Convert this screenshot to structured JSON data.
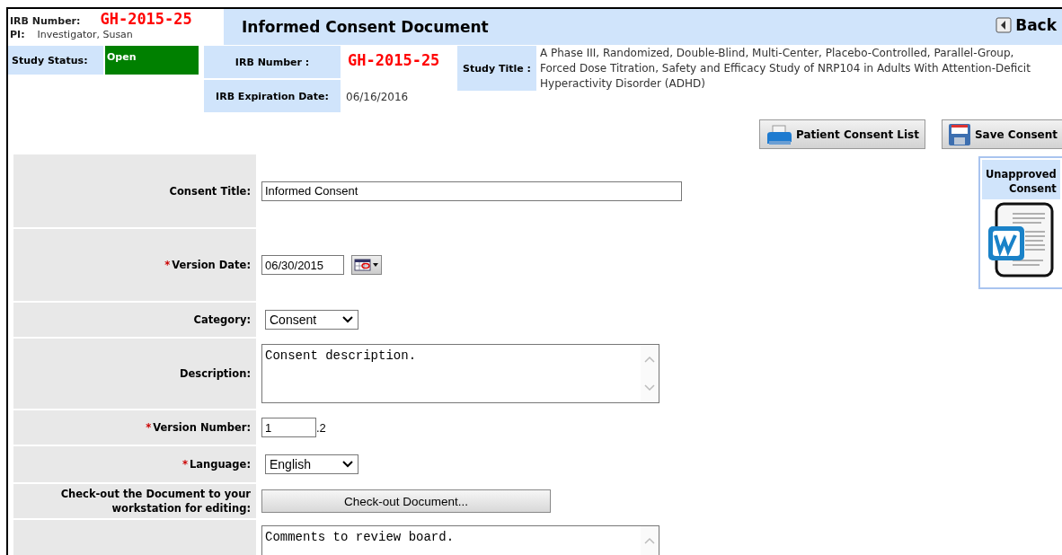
{
  "header": {
    "irb_label": "IRB Number:",
    "irb_number": "GH-2015-25",
    "pi_label": "PI:",
    "pi_name": "Investigator, Susan",
    "title": "Informed Consent Document",
    "back_button": "Back"
  },
  "study": {
    "status_label": "Study Status:",
    "status": "Open",
    "irb_label": "IRB Number :",
    "irb_number": "GH-2015-25",
    "expiration_label": "IRB Expiration Date:",
    "expiration_date": "06/16/2016",
    "title_label": "Study Title :",
    "title": "A Phase III, Randomized, Double-Blind, Multi-Center, Placebo-Controlled, Parallel-Group, Forced Dose Titration, Safety and Efficacy Study of NRP104 in Adults With Attention-Deficit Hyperactivity Disorder (ADHD)"
  },
  "actions": [
    "Patient Consent List",
    "Save Consent"
  ],
  "document": {
    "heading": "Unapproved Consent"
  },
  "form": [
    {
      "kind": "text",
      "label": "Consent Title:",
      "value": "Informed Consent"
    },
    {
      "kind": "date",
      "required_mark": "*",
      "label": "Version Date:",
      "value": "06/30/2015"
    },
    {
      "kind": "select",
      "label": "Category:",
      "value": "Consent"
    },
    {
      "kind": "textarea",
      "label": "Description:",
      "value": "Consent description."
    },
    {
      "kind": "version",
      "required_mark": "*",
      "label": "Version Number:",
      "value": "1",
      "suffix": ".2"
    },
    {
      "kind": "select",
      "required_mark": "*",
      "label": "Language:",
      "value": "English"
    },
    {
      "kind": "button",
      "label": "Check-out the Document to your workstation for editing:",
      "value": "Check-out Document..."
    },
    {
      "kind": "textarea",
      "value": "Comments to review board."
    }
  ]
}
